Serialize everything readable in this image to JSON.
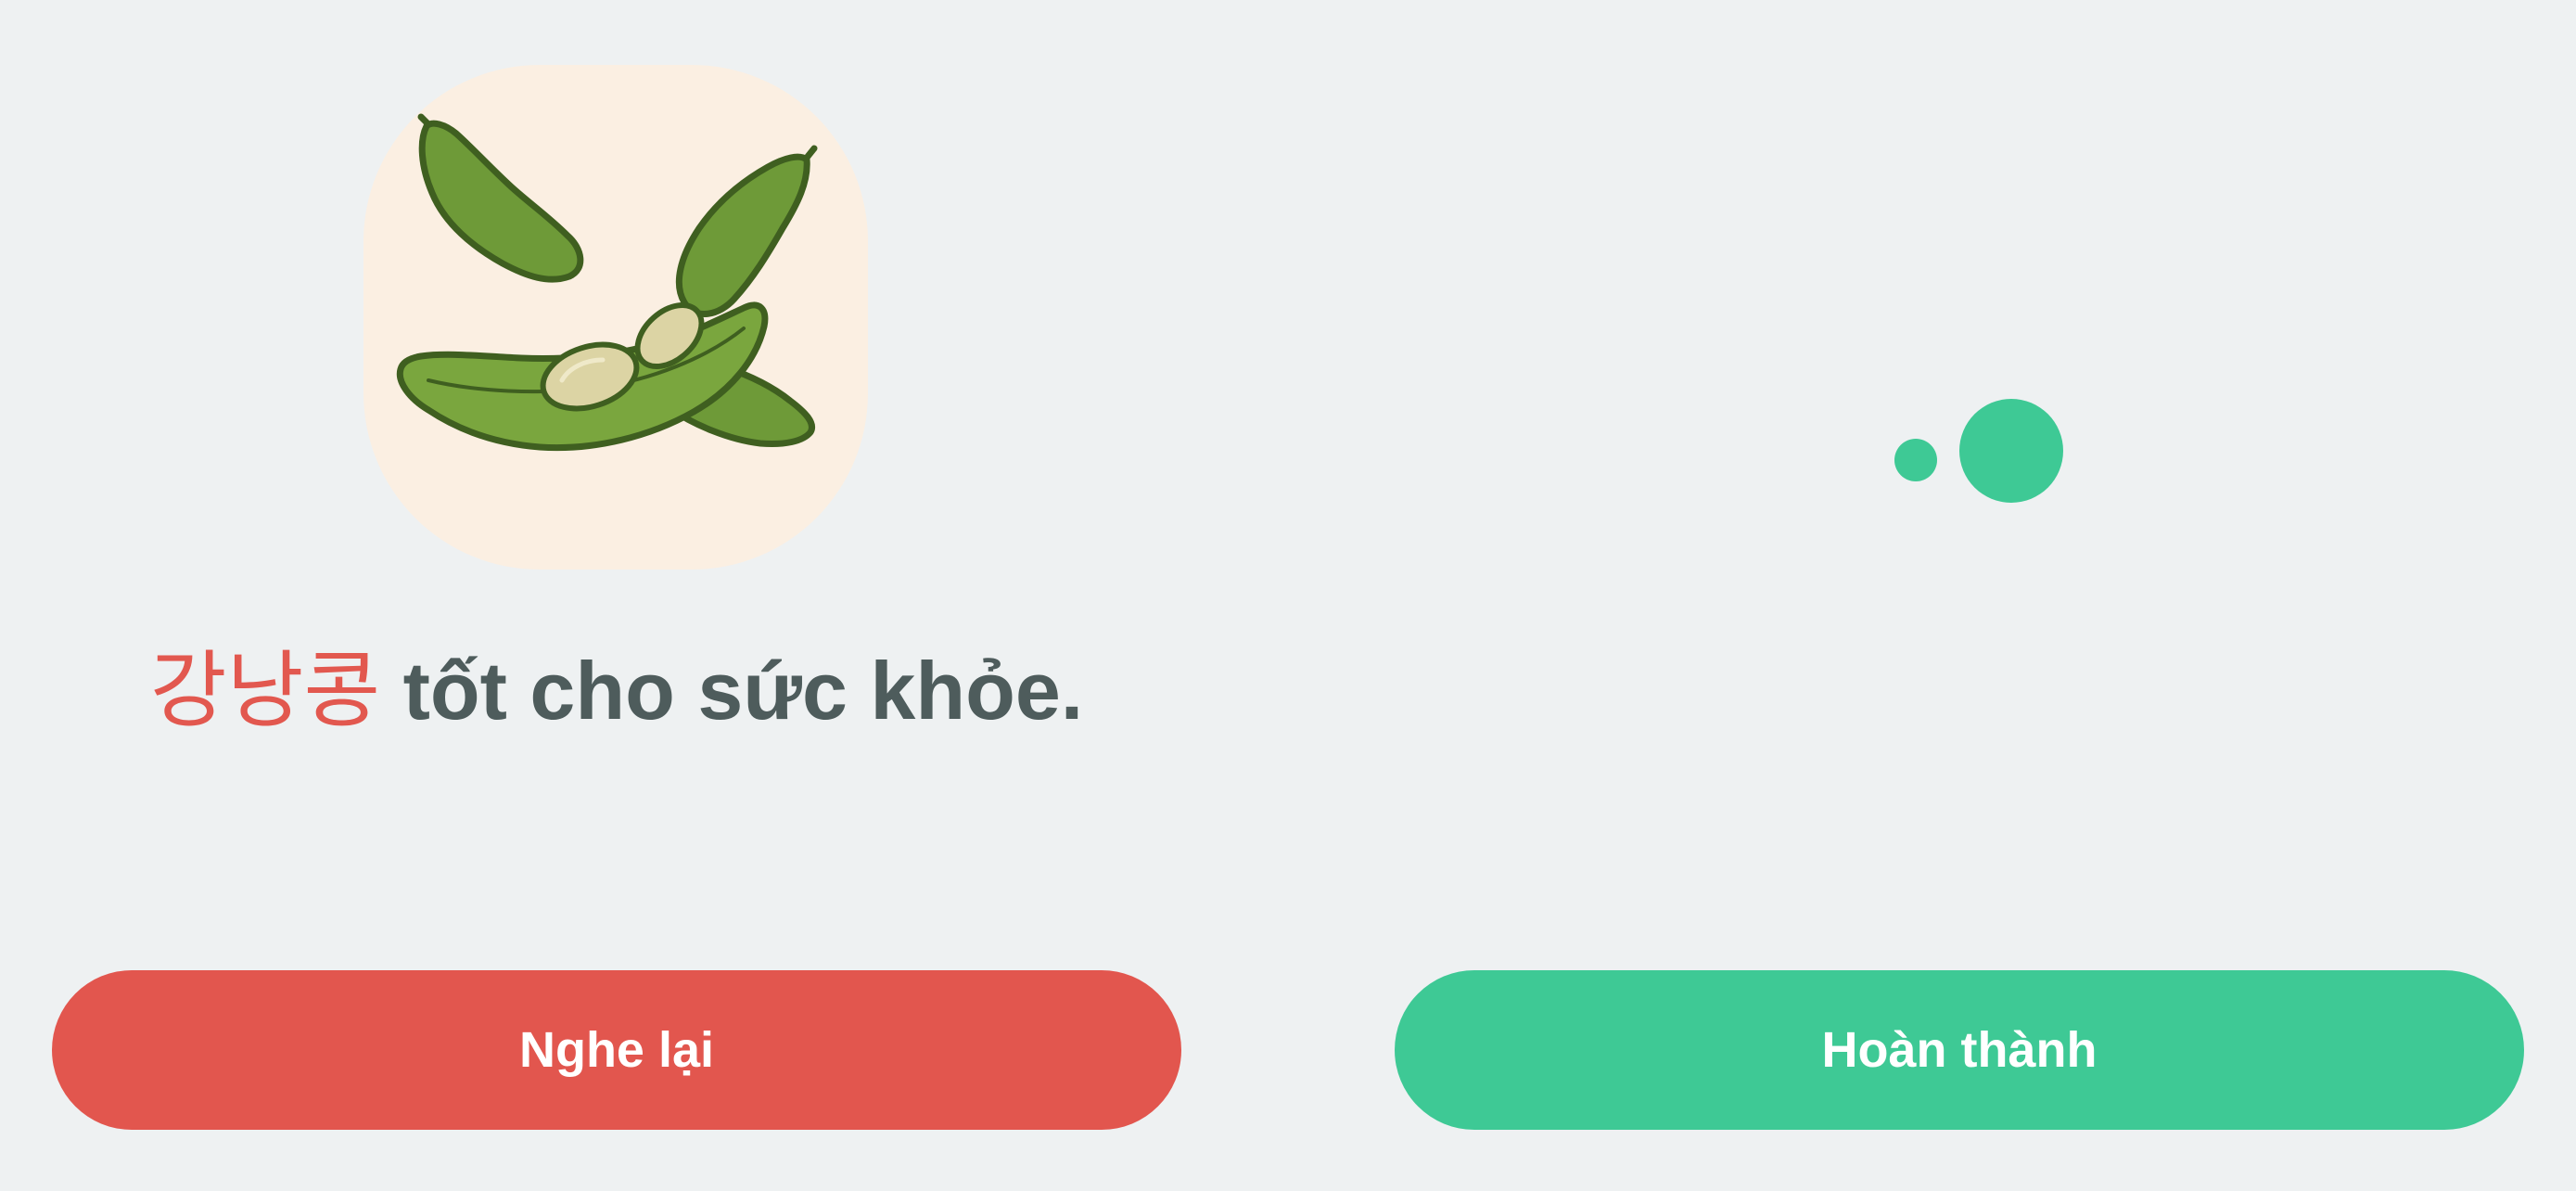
{
  "image": {
    "subject": "edamame-pods",
    "card_color": "#fbefe2"
  },
  "sentence": {
    "highlight_word": "강낭콩",
    "rest": " tốt cho sức khỏe."
  },
  "loading_indicator": {
    "color": "#3ec995"
  },
  "buttons": {
    "replay_label": "Nghe lại",
    "done_label": "Hoàn thành"
  },
  "colors": {
    "background": "#eef1f2",
    "highlight": "#e2584f",
    "text": "#4e5c5c",
    "replay_button": "#e2564e",
    "done_button": "#3ec995"
  }
}
